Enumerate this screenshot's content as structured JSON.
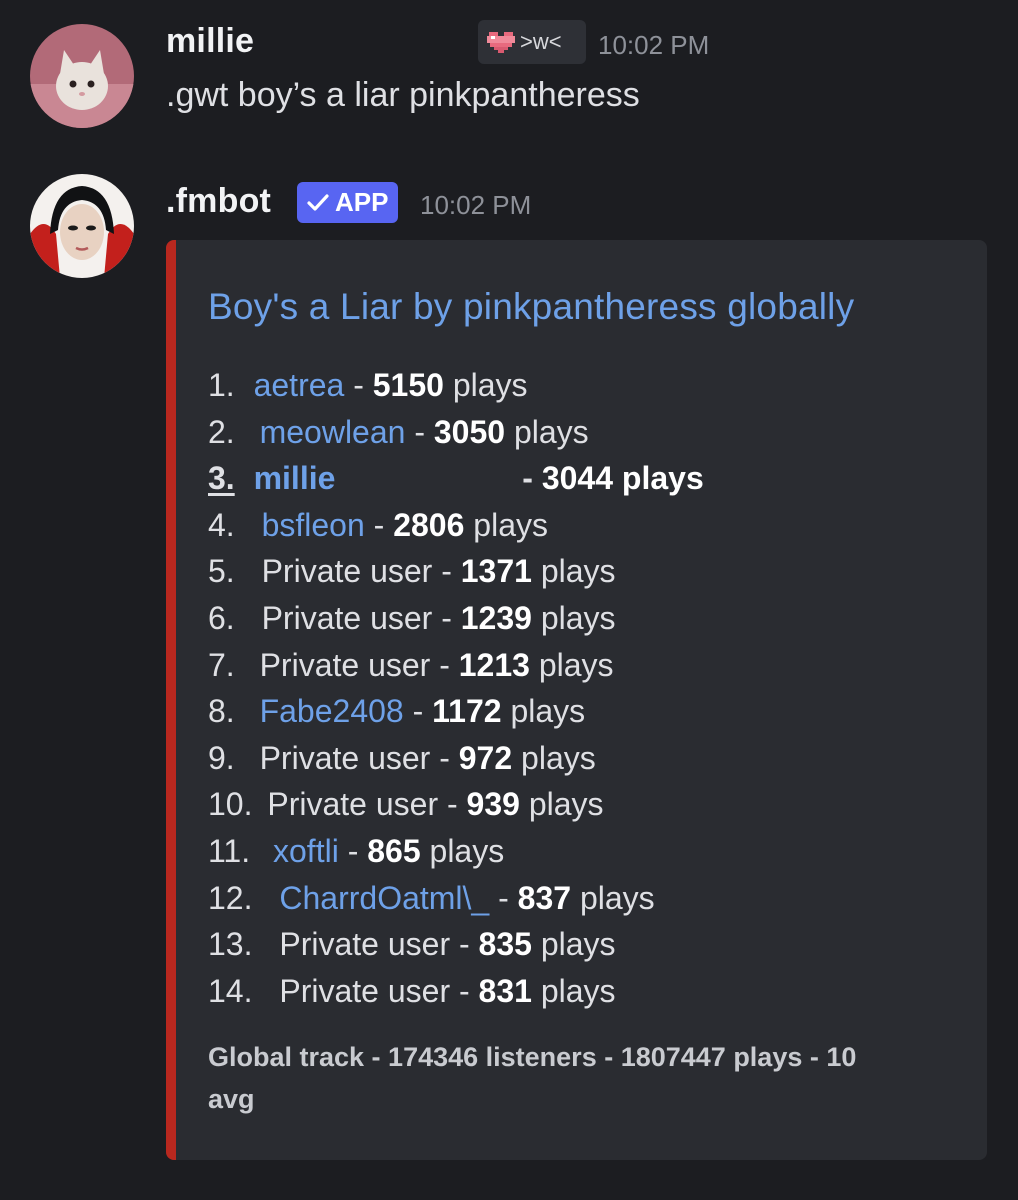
{
  "messages": [
    {
      "author": "millie",
      "status_emoji": "pixel-heart-icon",
      "status_text": ">w<",
      "time": "10:02 PM",
      "text": ".gwt boy’s a liar pinkpantheress"
    },
    {
      "author": ".fmbot",
      "badge": "APP",
      "time": "10:02 PM"
    }
  ],
  "embed": {
    "accent_color": "#b8281f",
    "title": "Boy's a Liar by pinkpantheress globally",
    "rows": [
      {
        "rank": "1.",
        "user": "aetrea",
        "sep": " - ",
        "count": "5150",
        "unit": " plays"
      },
      {
        "rank": "2.",
        "user": "meowlean",
        "sep": " - ",
        "count": "3050",
        "unit": " plays"
      },
      {
        "rank": "3.",
        "user": "millie",
        "sep": " - ",
        "count": "3044",
        "unit": " plays"
      },
      {
        "rank": "4.",
        "user": "bsfleon",
        "sep": " - ",
        "count": "2806",
        "unit": " plays"
      },
      {
        "rank": "5.",
        "user": "Private user",
        "sep": " - ",
        "count": "1371",
        "unit": " plays"
      },
      {
        "rank": "6.",
        "user": "Private user",
        "sep": " - ",
        "count": "1239",
        "unit": " plays"
      },
      {
        "rank": "7.",
        "user": "Private user",
        "sep": " - ",
        "count": "1213",
        "unit": " plays"
      },
      {
        "rank": "8.",
        "user": "Fabe2408",
        "sep": " - ",
        "count": "1172",
        "unit": " plays"
      },
      {
        "rank": "9.",
        "user": "Private user",
        "sep": " - ",
        "count": "972",
        "unit": " plays"
      },
      {
        "rank": "10.",
        "user": "Private user",
        "sep": " - ",
        "count": "939",
        "unit": " plays"
      },
      {
        "rank": "11.",
        "user": "xoftli",
        "sep": " - ",
        "count": "865",
        "unit": " plays"
      },
      {
        "rank": "12.",
        "user": "CharrdOatml\\_",
        "sep": " - ",
        "count": "837",
        "unit": " plays"
      },
      {
        "rank": "13.",
        "user": "Private user",
        "sep": " - ",
        "count": "835",
        "unit": " plays"
      },
      {
        "rank": "14.",
        "user": "Private user",
        "sep": " - ",
        "count": "831",
        "unit": " plays"
      }
    ],
    "footer": "Global track - 174346 listeners - 1807447 plays - 10 avg"
  },
  "colors": {
    "background": "#1c1d21",
    "embed_background": "#2a2c31",
    "link": "#6ea1e8",
    "app_badge": "#5865f2"
  }
}
